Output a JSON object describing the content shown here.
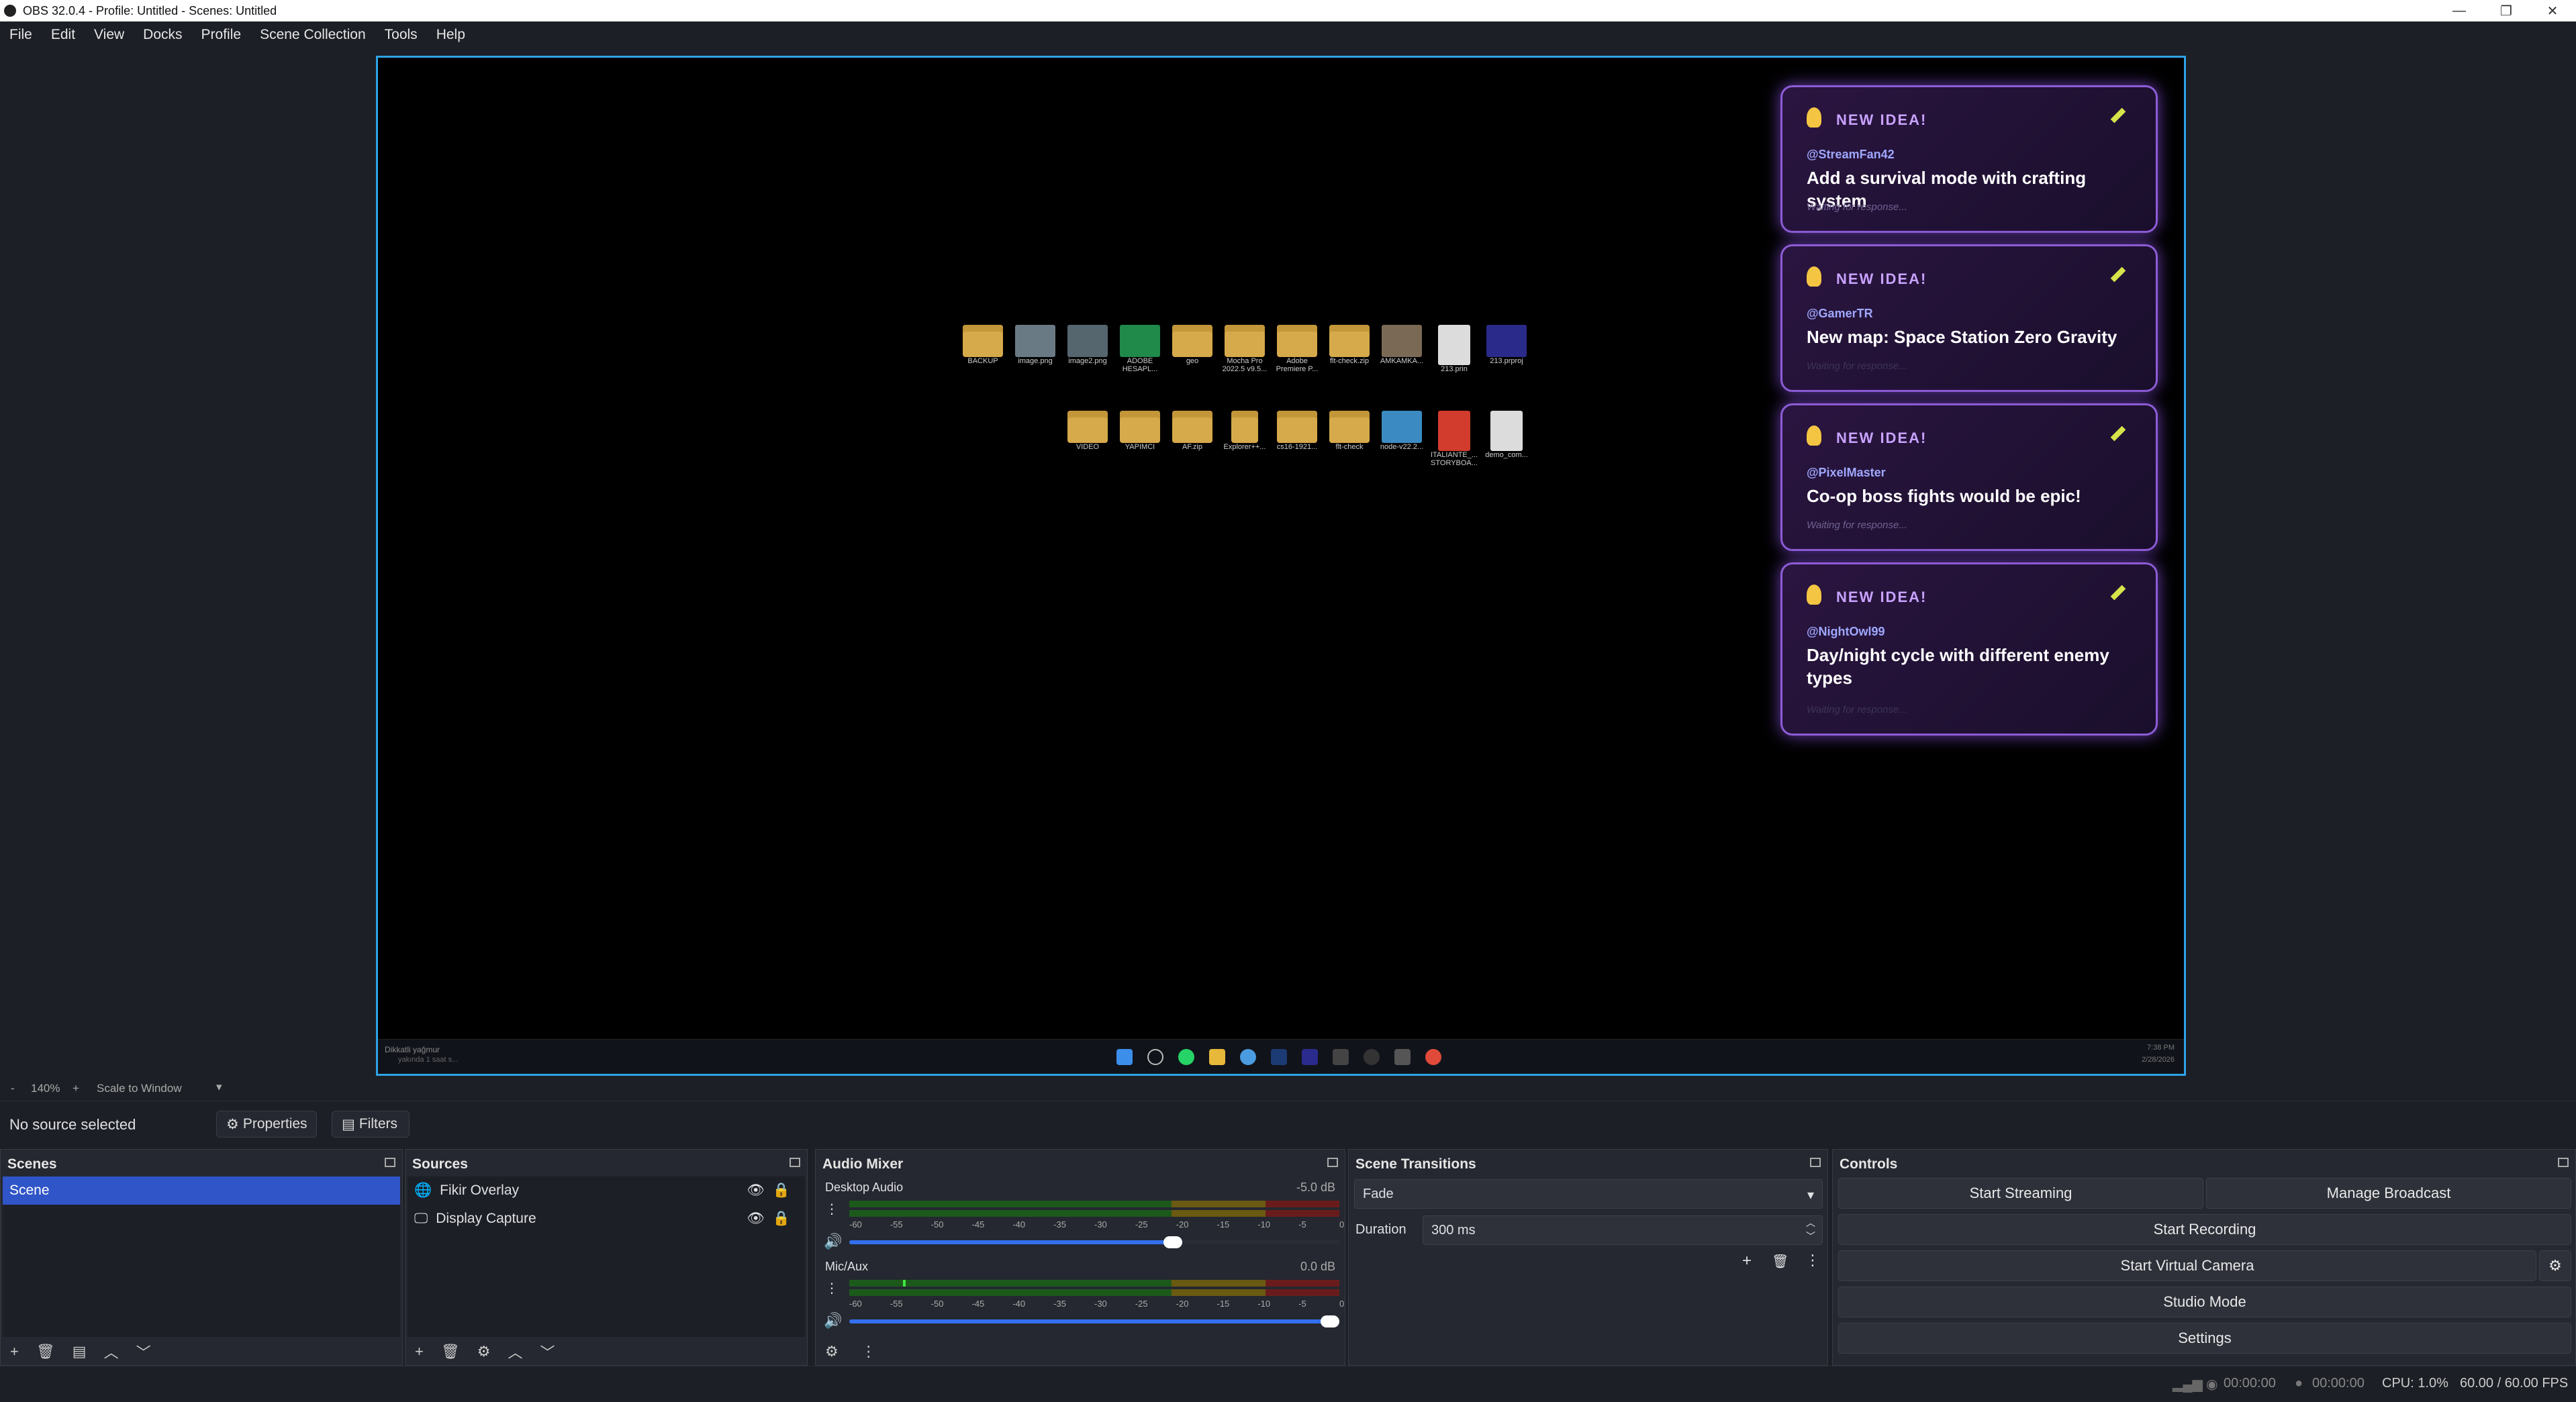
{
  "window": {
    "title": "OBS 32.0.4 - Profile: Untitled - Scenes: Untitled"
  },
  "menu": [
    "File",
    "Edit",
    "View",
    "Docks",
    "Profile",
    "Scene Collection",
    "Tools",
    "Help"
  ],
  "desktop": {
    "row1": [
      "BACKUP",
      "image.png",
      "image2.png",
      "ADOBE HESAPL...",
      "geo",
      "Mocha Pro 2022.5 v9.5...",
      "Adobe Premiere P...",
      "flt-check.zip",
      "AMKAMKA...",
      "213.prin",
      "213.prproj"
    ],
    "row2": [
      "VIDEO",
      "YAPIMCI",
      "AF.zip",
      "Explorer++...",
      "cs16-1921...",
      "flt-check",
      "node-v22.2...",
      "ITALIANTE_... STORYBOA...",
      "demo_com..."
    ],
    "taskbar_notice": "Dikkatli yağmur",
    "taskbar_notice_sub": "yakında 1 saat s...",
    "clock_time": "7:38 PM",
    "clock_date": "2/28/2026"
  },
  "cards": [
    {
      "header": "NEW IDEA!",
      "user": "@StreamFan42",
      "message": "Add a survival mode with crafting system",
      "status": "Waiting for response..."
    },
    {
      "header": "NEW IDEA!",
      "user": "@GamerTR",
      "message": "New map: Space Station Zero Gravity",
      "status": "Waiting for response..."
    },
    {
      "header": "NEW IDEA!",
      "user": "@PixelMaster",
      "message": "Co-op boss fights would be epic!",
      "status": "Waiting for response..."
    },
    {
      "header": "NEW IDEA!",
      "user": "@NightOwl99",
      "message": "Day/night cycle with different enemy types",
      "status": "Waiting for response..."
    }
  ],
  "zoom": {
    "minus": "-",
    "level": "140%",
    "plus": "+",
    "mode": "Scale to Window"
  },
  "selection": {
    "label": "No source selected",
    "properties": "Properties",
    "filters": "Filters"
  },
  "scenes": {
    "title": "Scenes",
    "items": [
      "Scene"
    ]
  },
  "sources": {
    "title": "Sources",
    "items": [
      "Fikir Overlay",
      "Display Capture"
    ]
  },
  "mixer": {
    "title": "Audio Mixer",
    "channels": [
      {
        "name": "Desktop Audio",
        "db": "-5.0 dB",
        "volume": 0.68
      },
      {
        "name": "Mic/Aux",
        "db": "0.0 dB",
        "volume": 1.0
      }
    ],
    "ticks": [
      "-60",
      "-55",
      "-50",
      "-45",
      "-40",
      "-35",
      "-30",
      "-25",
      "-20",
      "-15",
      "-10",
      "-5",
      "0"
    ]
  },
  "transitions": {
    "title": "Scene Transitions",
    "type": "Fade",
    "duration_label": "Duration",
    "duration": "300 ms"
  },
  "controls": {
    "title": "Controls",
    "start_streaming": "Start Streaming",
    "manage_broadcast": "Manage Broadcast",
    "start_recording": "Start Recording",
    "start_virtual_camera": "Start Virtual Camera",
    "studio_mode": "Studio Mode",
    "settings": "Settings"
  },
  "status": {
    "stream_time": "00:00:00",
    "record_time": "00:00:00",
    "cpu": "CPU: 1.0%",
    "fps": "60.00 / 60.00 FPS"
  },
  "colors": {
    "accent": "#2ea3e6",
    "selection": "#2f55c8",
    "card_border": "#8d5cd6"
  }
}
